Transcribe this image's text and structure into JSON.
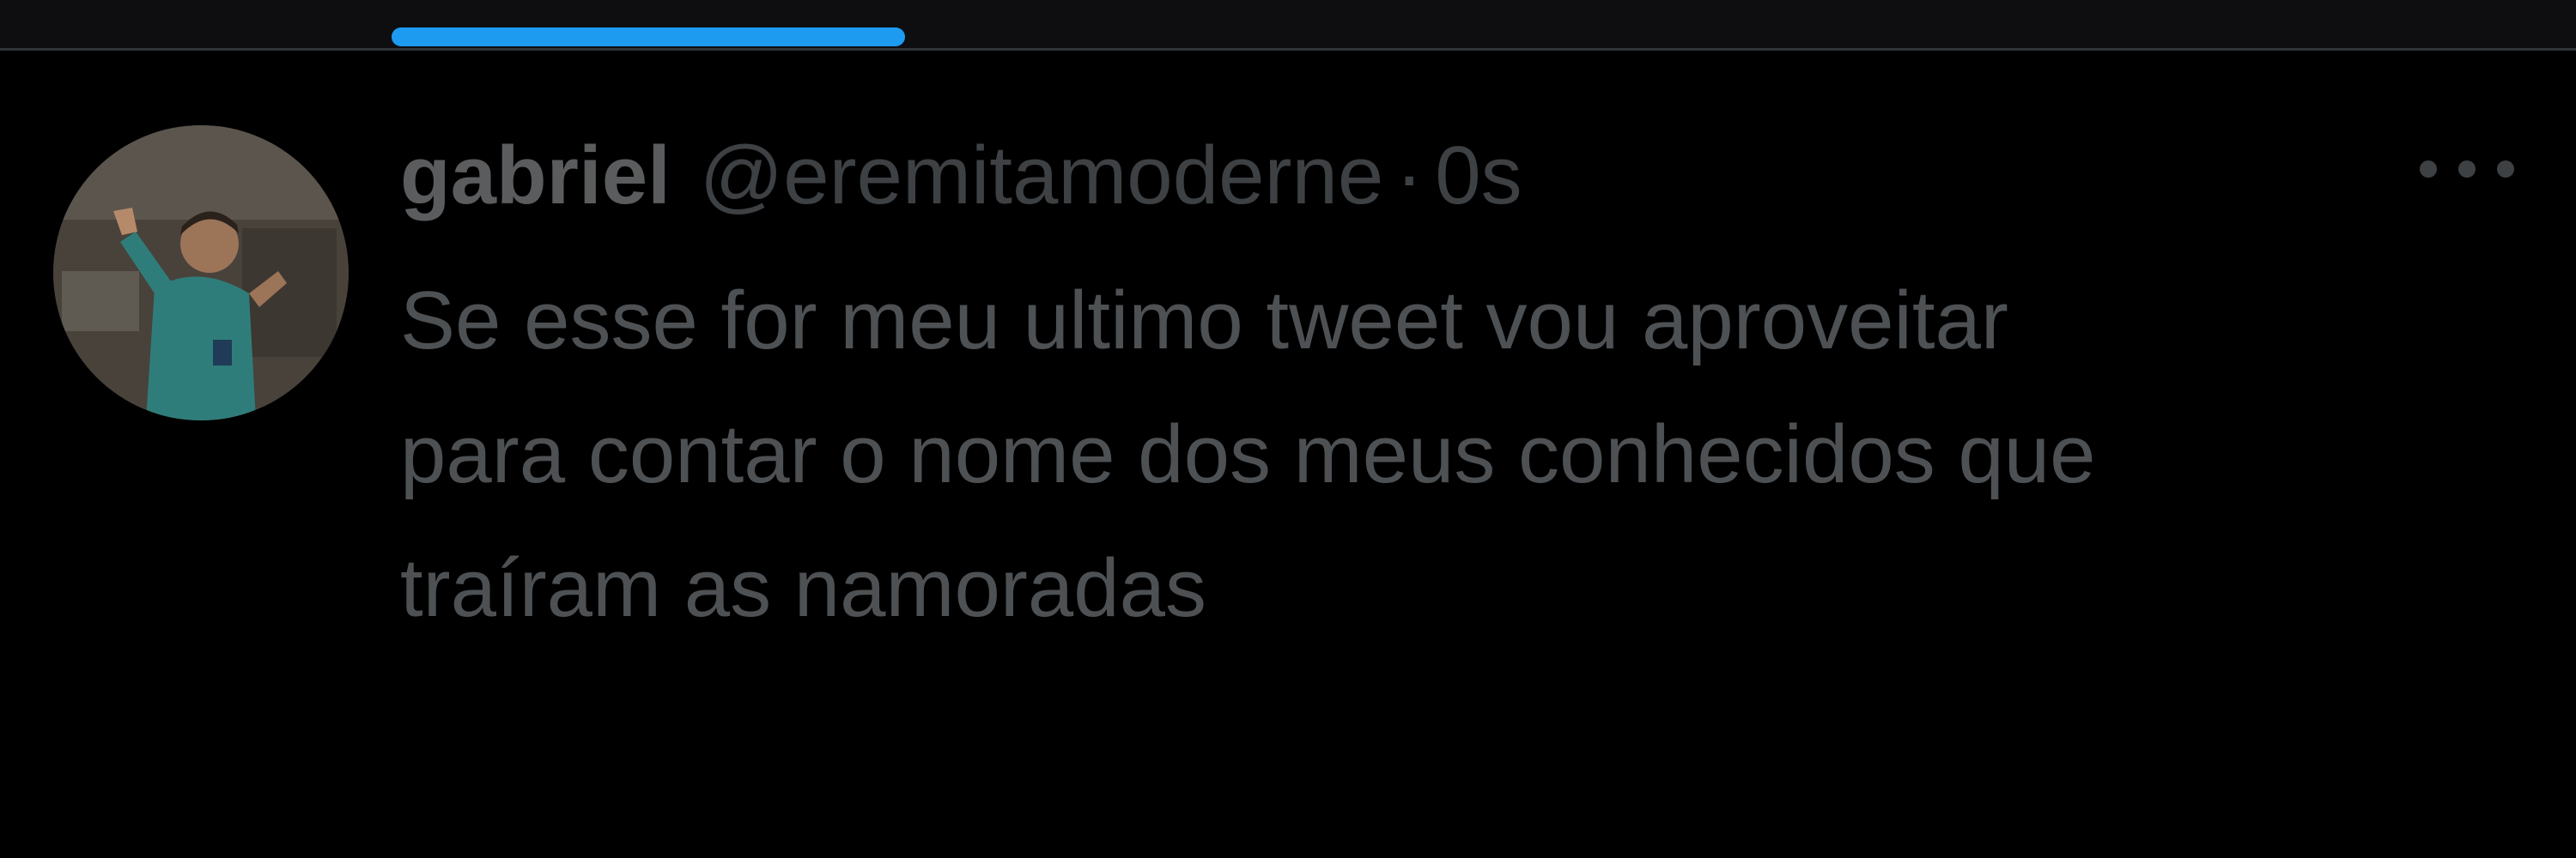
{
  "tweet": {
    "author": {
      "display_name": "gabriel",
      "handle": "@eremitamoderne"
    },
    "separator": "·",
    "timestamp": "0s",
    "text": "Se esse for meu ultimo tweet vou aproveitar\npara contar o nome dos meus conhecidos que\ntraíram as namoradas",
    "more_icon": "more-horizontal-icon"
  },
  "colors": {
    "background": "#000000",
    "accent": "#1d9bf0",
    "divider": "#2f3336",
    "name_text": "#5a5c5e",
    "meta_text": "#3e4144",
    "body_text": "#4e5154"
  }
}
